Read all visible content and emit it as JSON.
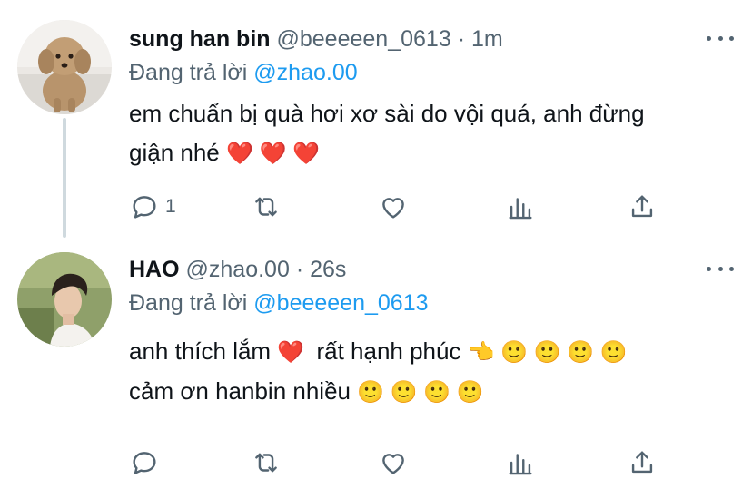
{
  "tweets": [
    {
      "author": {
        "name": "sung han bin",
        "handle": "@beeeeen_0613"
      },
      "separator": "·",
      "time": "1m",
      "replying_prefix": "Đang trả lời",
      "replying_to": "@zhao.00",
      "text_line1": "em chuẩn bị quà hơi xơ sài do vội quá, anh đừng",
      "text_line2": "giận nhé",
      "text_line2_emoji": "❤️ ❤️ ❤️",
      "reply_count": "1",
      "avatar_icon": "poodle-dog-photo"
    },
    {
      "author": {
        "name": "HAO",
        "handle": "@zhao.00"
      },
      "separator": "·",
      "time": "26s",
      "replying_prefix": "Đang trả lời",
      "replying_to": "@beeeeen_0613",
      "text_line1a": "anh thích lắm",
      "text_line1a_emoji": "❤️",
      "text_line1b": "rất hạnh phúc",
      "text_line1b_emoji": "👈 🙂 🙂 🙂 🙂",
      "text_line2": "cảm ơn hanbin nhiều",
      "text_line2_emoji": "🙂 🙂 🙂 🙂",
      "reply_count": "",
      "avatar_icon": "person-photo"
    }
  ],
  "colors": {
    "text": "#0f1419",
    "secondary": "#536471",
    "link": "#1d9bf0",
    "thread_line": "#cfd9de"
  },
  "icons": [
    "reply-icon",
    "retweet-icon",
    "like-icon",
    "stats-icon",
    "share-icon",
    "more-icon"
  ]
}
